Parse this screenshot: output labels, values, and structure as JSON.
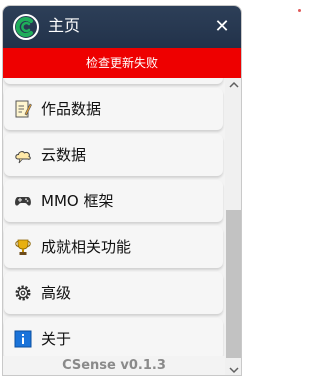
{
  "window": {
    "title": "主页",
    "close_glyph": "✕"
  },
  "banner": {
    "text": "检查更新失败",
    "color": "#ee0000"
  },
  "menu": {
    "items": [
      {
        "label": "作品数据",
        "icon": "memo-icon"
      },
      {
        "label": "云数据",
        "icon": "cloud-icon"
      },
      {
        "label": "MMO 框架",
        "icon": "gamepad-icon"
      },
      {
        "label": "成就相关功能",
        "icon": "trophy-icon"
      },
      {
        "label": "高级",
        "icon": "gear-icon"
      },
      {
        "label": "关于",
        "icon": "info-icon"
      }
    ]
  },
  "footer": {
    "version": "CSense v0.1.3"
  },
  "colors": {
    "titlebar": "#22324a",
    "accent": "#ee0000",
    "logo": "#1fae5a"
  }
}
